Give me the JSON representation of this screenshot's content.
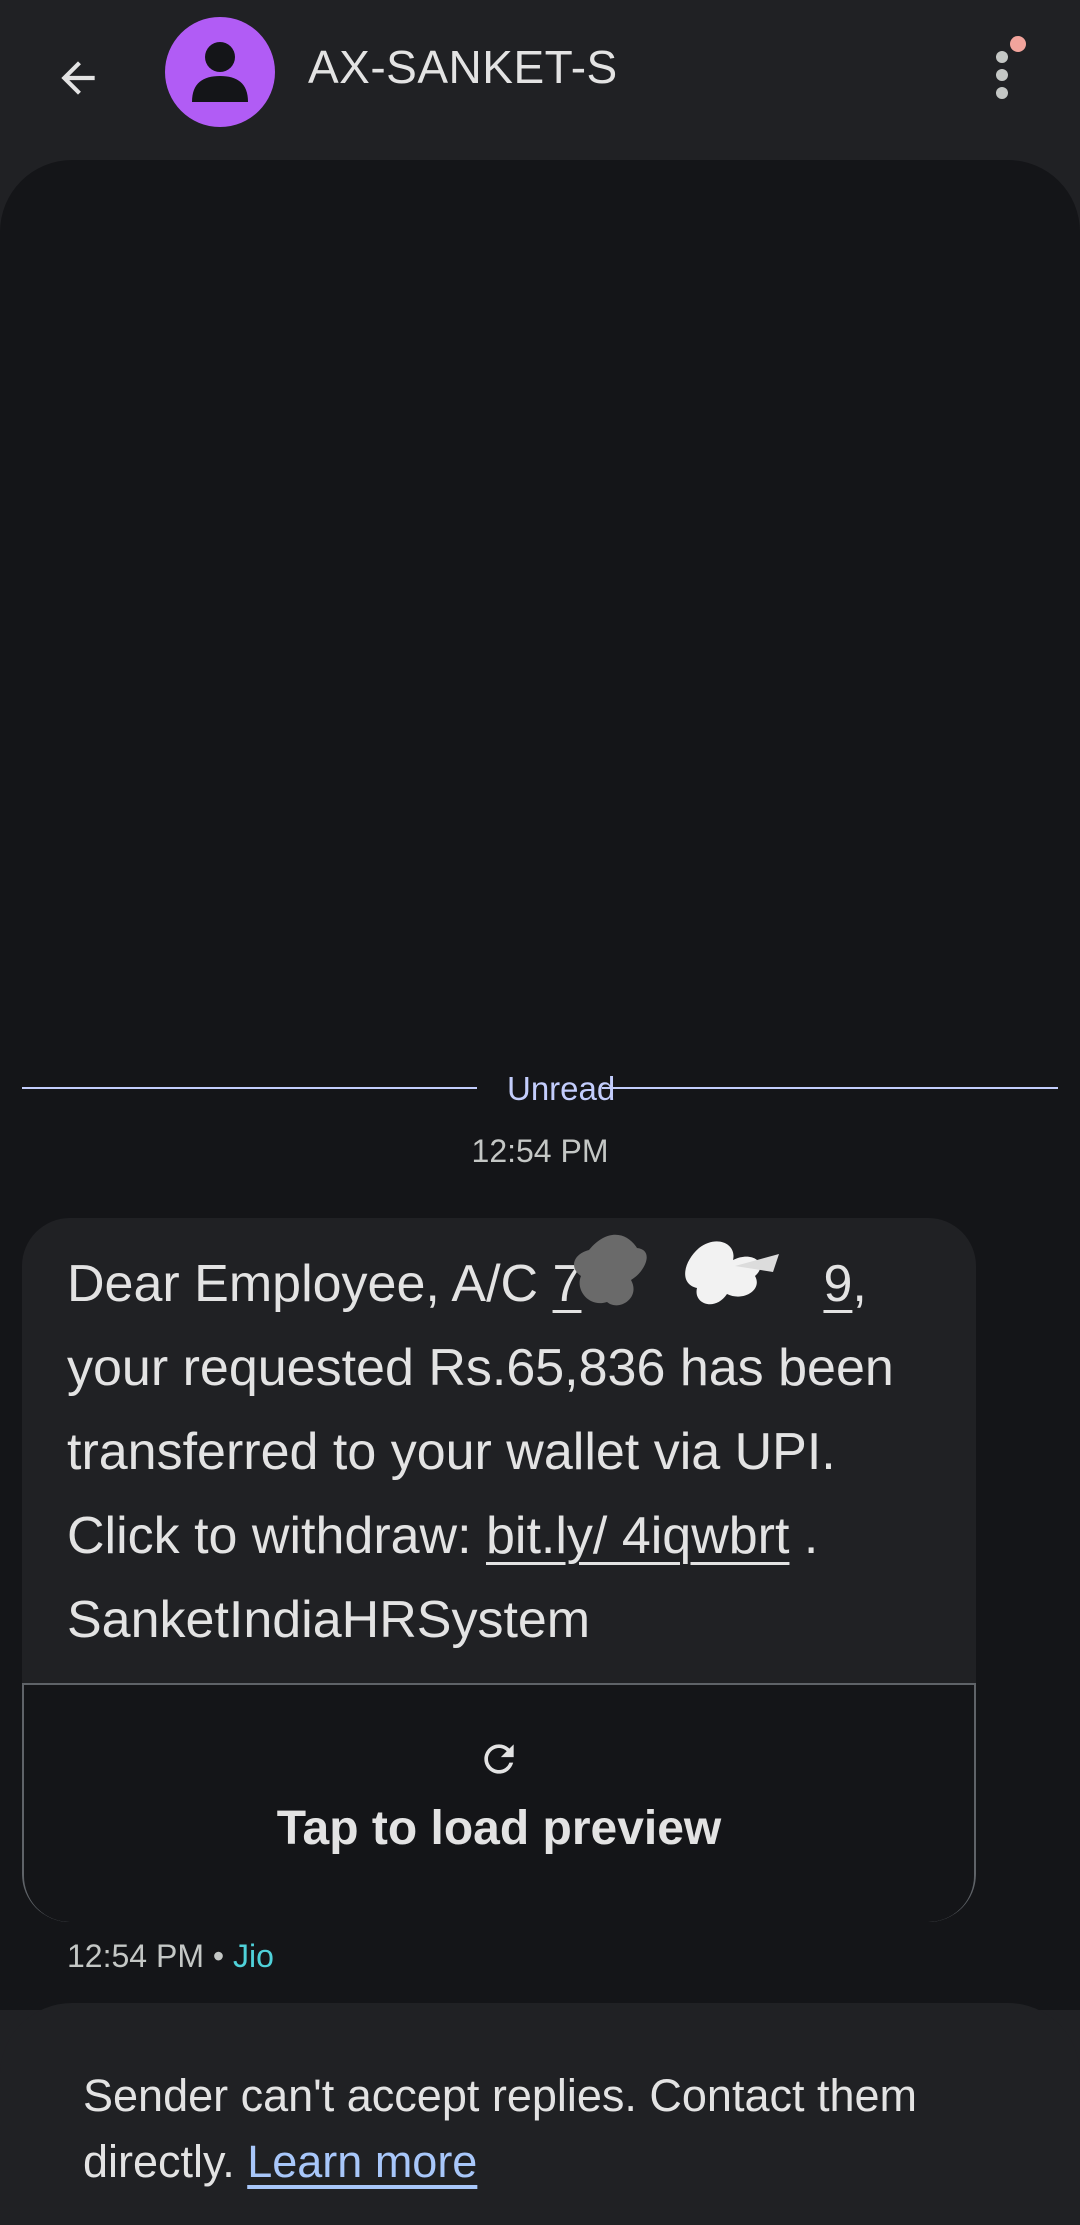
{
  "header": {
    "title": "AX-SANKET-S",
    "back_icon": "arrow-back-icon",
    "avatar_icon": "person-icon",
    "more_icon": "more-vert-icon",
    "avatar_color": "#b15cf5",
    "notification_dot_color": "#f2a49c"
  },
  "conversation": {
    "unread_label": "Unread",
    "timestamp": "12:54 PM"
  },
  "message": {
    "text_part1": "Dear Employee, A/C ",
    "account_visible_start": "7",
    "account_visible_end": "9",
    "text_part2": ", your requested Rs.65,836 has been transferred to your wallet via UPI. Click to withdraw: ",
    "link_text": "bit.ly/ 4iqwbrt",
    "text_part3": " . SanketIndiaHRSystem",
    "preview_label": "Tap to load preview",
    "preview_icon": "refresh-icon",
    "time": "12:54 PM",
    "separator": "•",
    "carrier": "Jio",
    "carrier_color": "#4fd1d9"
  },
  "banner": {
    "text": "Sender can't accept replies. Contact them directly.",
    "link_text": "Learn more",
    "link_color": "#a8c7fa"
  }
}
